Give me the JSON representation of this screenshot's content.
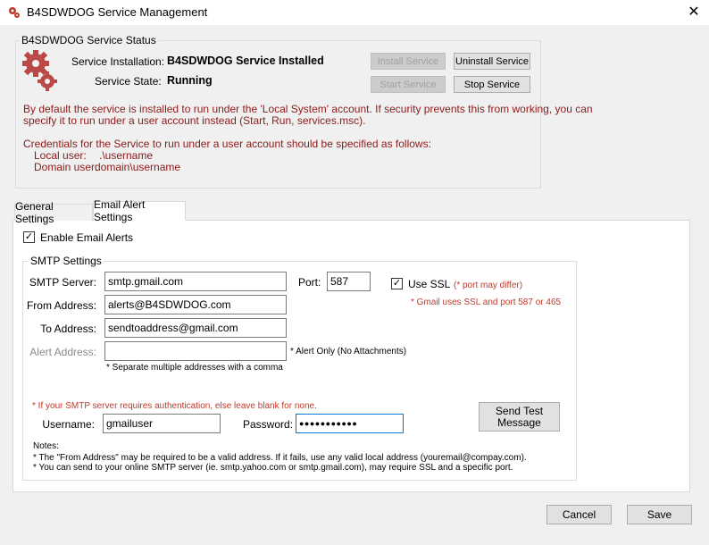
{
  "window": {
    "title": "B4SDWDOG Service Management",
    "close_glyph": "✕"
  },
  "status": {
    "group_title": "B4SDWDOG Service Status",
    "installation_label": "Service Installation:",
    "installation_value": "B4SDWDOG Service Installed",
    "state_label": "Service State:",
    "state_value": "Running",
    "install_button": "Install Service",
    "uninstall_button": "Uninstall Service",
    "start_button": "Start Service",
    "stop_button": "Stop Service",
    "info_line1": "By default the service is installed to run under the 'Local System' account. If security prevents this from working, you can",
    "info_line2": "specify it to run under a user account instead (Start, Run, services.msc).",
    "cred_line": "Credentials for the Service to run under a user account should be specified as follows:",
    "local_user_label": "Local user:",
    "local_user_value": ".\\username",
    "domain_user_label": "Domain user:",
    "domain_user_value": "domain\\username"
  },
  "tabs": [
    {
      "label": "General Settings",
      "active": false
    },
    {
      "label": "Email Alert Settings",
      "active": true
    }
  ],
  "email": {
    "enable_label": "Enable Email Alerts",
    "enable_checked": true,
    "smtp_group_title": "SMTP Settings",
    "smtp_server_label": "SMTP Server:",
    "smtp_server_value": "smtp.gmail.com",
    "port_label": "Port:",
    "port_value": "587",
    "use_ssl_label": "Use SSL",
    "use_ssl_checked": true,
    "port_note": "(* port may differ)",
    "gmail_note": "* Gmail uses SSL and port 587 or 465",
    "from_label": "From Address:",
    "from_value": "alerts@B4SDWDOG.com",
    "to_label": "To Address:",
    "to_value": "sendtoaddress@gmail.com",
    "alert_label": "Alert Address:",
    "alert_value": "",
    "alert_note": "* Alert Only (No Attachments)",
    "separate_note": "* Separate multiple addresses with a comma",
    "auth_note": "* If your SMTP server requires authentication, else leave blank for none.",
    "username_label": "Username:",
    "username_value": "gmailuser",
    "password_label": "Password:",
    "password_value": "●●●●●●●●●●●",
    "send_test_line1": "Send Test",
    "send_test_line2": "Message",
    "notes_title": "Notes:",
    "note1": "* The \"From Address\" may be required to be a valid address. If it fails, use any valid local address (youremail@compay.com).",
    "note2": "* You can send to your online SMTP server (ie. smtp.yahoo.com or smtp.gmail.com), may require SSL and a specific port."
  },
  "footer": {
    "cancel": "Cancel",
    "save": "Save"
  },
  "check_glyph": "✓",
  "icons": {
    "app": "gears-icon",
    "status": "gears-icon"
  },
  "colors": {
    "note_red": "#8b1a1a",
    "focus_blue": "#0078d7"
  }
}
